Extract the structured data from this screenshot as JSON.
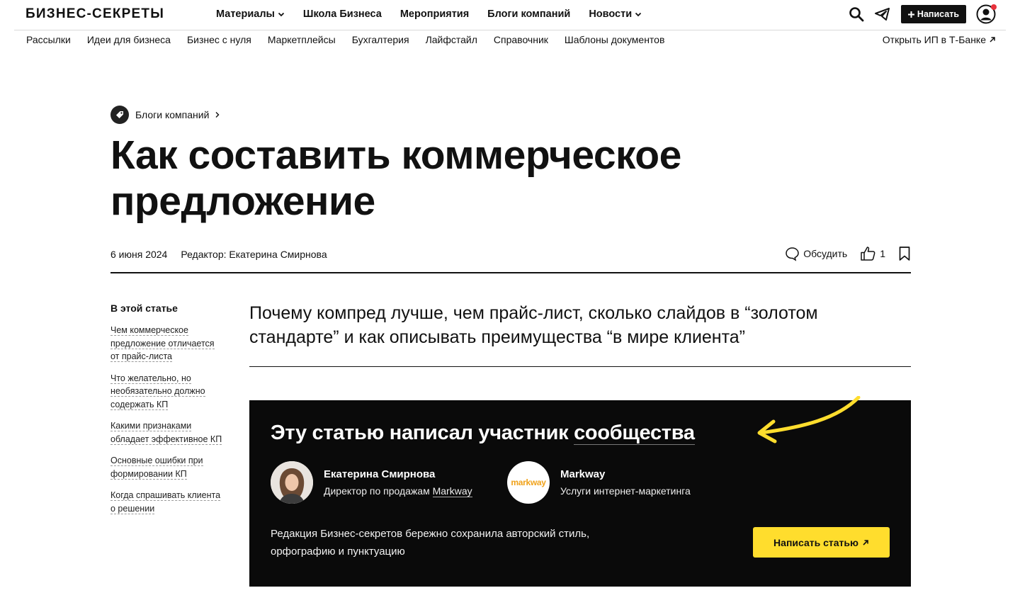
{
  "header": {
    "logo": "БИЗНЕС-СЕКРЕТЫ",
    "nav": [
      {
        "label": "Материалы",
        "dropdown": true
      },
      {
        "label": "Школа Бизнеса",
        "dropdown": false
      },
      {
        "label": "Мероприятия",
        "dropdown": false
      },
      {
        "label": "Блоги компаний",
        "dropdown": false
      },
      {
        "label": "Новости",
        "dropdown": true
      }
    ],
    "write_label": "Написать",
    "icons": [
      "search-icon",
      "telegram-icon",
      "plus-icon",
      "user-icon"
    ],
    "accent": "#e8323c"
  },
  "subnav": {
    "items": [
      "Рассылки",
      "Идеи для бизнеса",
      "Бизнес с нуля",
      "Маркетплейсы",
      "Бухгалтерия",
      "Лайфстайл",
      "Справочник",
      "Шаблоны документов"
    ],
    "promo": "Открыть ИП в Т-Банке"
  },
  "article": {
    "breadcrumb": "Блоги компаний",
    "title": "Как составить коммерческое предложение",
    "date": "6 июня 2024",
    "editor": "Редактор: Екатерина Смирнова",
    "discuss_label": "Обсудить",
    "likes": "1",
    "lead": "Почему компред лучше, чем прайс-лист, сколько слайдов в “золотом стандарте” и как описывать преимущества “в мире клиента”"
  },
  "toc": {
    "title": "В этой статье",
    "items": [
      "Чем коммерческое предложение отличается от прайс-листа",
      "Что желательно, но необязательно должно содержать КП",
      "Какими признаками обладает эффективное КП",
      "Основные ошибки при формировании КП",
      "Когда спрашивать клиента о решении"
    ]
  },
  "community": {
    "title_prefix": "Эту статью написал участник ",
    "title_link": "сообщества",
    "author": {
      "name": "Екатерина Смирнова",
      "desc_prefix": "Директор по продажам ",
      "desc_link": "Markway"
    },
    "company": {
      "name": "Markway",
      "desc": "Услуги интернет-маркетинга",
      "logo_text": "markway"
    },
    "note": "Редакция Бизнес-секретов бережно сохранила авторский стиль, орфографию и пунктуацию",
    "button": "Написать статью",
    "colors": {
      "background": "#0a0a0a",
      "button": "#ffdd2d",
      "arrow": "#ffdd2d"
    }
  }
}
